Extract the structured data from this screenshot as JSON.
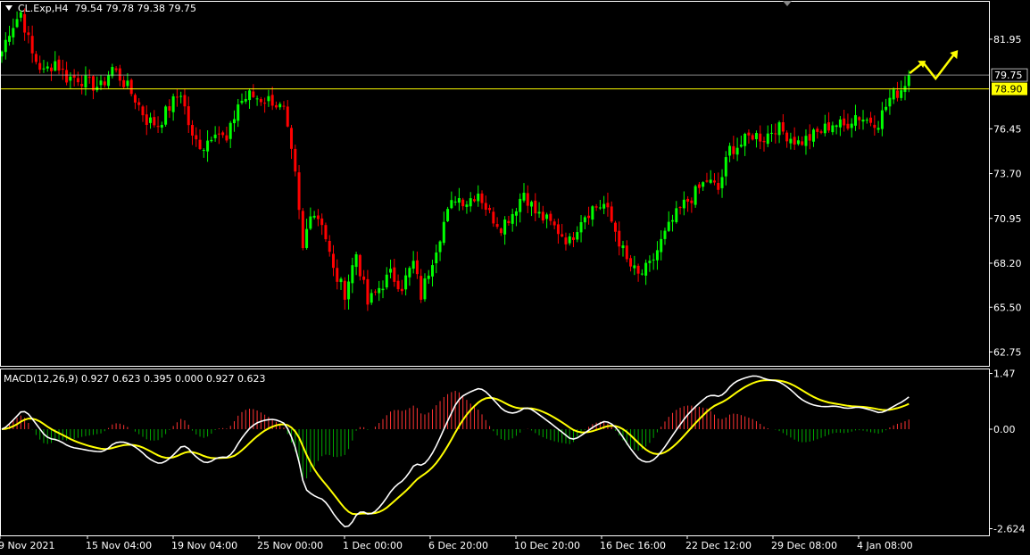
{
  "header": {
    "symbol": "CL.Exp,H4",
    "ohlc": "79.54 79.78 79.38 79.75"
  },
  "macd_header": {
    "label": "MACD(12,26,9) 0.927 0.623 0.395 0.000 0.927 0.623"
  },
  "colors": {
    "background": "#000000",
    "bull_candle": "#00ff00",
    "bear_candle": "#ff0000",
    "macd_line": "#ffffff",
    "signal_line": "#ffff00",
    "hist_pos": "#ff3333",
    "hist_neg": "#00aa00",
    "current_price_tag": "#ffff00",
    "axis": "#ffffff",
    "hline": "#c0c0c0"
  },
  "price_panel": {
    "ticks": [
      "81.95",
      "76.45",
      "73.70",
      "70.95",
      "68.20",
      "65.50",
      "62.75"
    ],
    "tick_values": [
      81.95,
      76.45,
      73.7,
      70.95,
      68.2,
      65.5,
      62.75
    ],
    "ylim": [
      61.9,
      84.3
    ],
    "hlines": [
      79.75,
      78.9
    ],
    "price_tags": [
      {
        "label": "79.75",
        "value": 79.75,
        "style": "line"
      },
      {
        "label": "78.90",
        "value": 78.9,
        "style": "box"
      }
    ]
  },
  "macd_panel": {
    "ticks": [
      "1.47",
      "0.00",
      "-2.624"
    ],
    "tick_values": [
      1.47,
      0.0,
      -2.624
    ],
    "ylim": [
      -2.8,
      1.6
    ]
  },
  "x_axis_labels": [
    "9 Nov 2021",
    "15 Nov 04:00",
    "19 Nov 04:00",
    "25 Nov 00:00",
    "1 Dec 00:00",
    "6 Dec 20:00",
    "10 Dec 20:00",
    "16 Dec 16:00",
    "22 Dec 12:00",
    "29 Dec 08:00",
    "4 Jan 08:00"
  ],
  "chart_data": {
    "type": "candlestick",
    "title": "CL.Exp,H4",
    "ylabel": "",
    "ylim": [
      61.9,
      84.3
    ],
    "grid": false,
    "close_path": [
      [
        0,
        81.2
      ],
      [
        2,
        82.5
      ],
      [
        5,
        83.6
      ],
      [
        8,
        81.0
      ],
      [
        11,
        79.9
      ],
      [
        14,
        80.6
      ],
      [
        17,
        79.6
      ],
      [
        20,
        79.6
      ],
      [
        23,
        79.2
      ],
      [
        26,
        79.0
      ],
      [
        29,
        80.2
      ],
      [
        32,
        79.3
      ],
      [
        35,
        78.3
      ],
      [
        38,
        77.0
      ],
      [
        41,
        76.7
      ],
      [
        44,
        77.8
      ],
      [
        47,
        78.7
      ],
      [
        50,
        75.8
      ],
      [
        53,
        75.4
      ],
      [
        56,
        76.5
      ],
      [
        59,
        75.6
      ],
      [
        62,
        78.0
      ],
      [
        65,
        78.5
      ],
      [
        68,
        78.3
      ],
      [
        71,
        78.2
      ],
      [
        74,
        77.5
      ],
      [
        77,
        73.5
      ],
      [
        79,
        69.0
      ],
      [
        81,
        71.5
      ],
      [
        84,
        70.8
      ],
      [
        87,
        67.7
      ],
      [
        90,
        66.4
      ],
      [
        93,
        68.8
      ],
      [
        96,
        65.7
      ],
      [
        99,
        66.7
      ],
      [
        102,
        67.5
      ],
      [
        105,
        66.8
      ],
      [
        108,
        68.2
      ],
      [
        110,
        66.2
      ],
      [
        113,
        68.5
      ],
      [
        116,
        70.7
      ],
      [
        119,
        72.3
      ],
      [
        122,
        72.0
      ],
      [
        125,
        72.6
      ],
      [
        128,
        71.2
      ],
      [
        131,
        70.5
      ],
      [
        134,
        71.3
      ],
      [
        137,
        72.6
      ],
      [
        140,
        71.3
      ],
      [
        143,
        70.8
      ],
      [
        146,
        70.2
      ],
      [
        149,
        69.5
      ],
      [
        152,
        71.0
      ],
      [
        155,
        71.6
      ],
      [
        158,
        71.8
      ],
      [
        161,
        70.2
      ],
      [
        164,
        68.3
      ],
      [
        167,
        67.4
      ],
      [
        170,
        68.0
      ],
      [
        173,
        69.5
      ],
      [
        176,
        70.8
      ],
      [
        179,
        71.8
      ],
      [
        182,
        72.5
      ],
      [
        185,
        73.3
      ],
      [
        188,
        72.7
      ],
      [
        191,
        75.2
      ],
      [
        194,
        75.5
      ],
      [
        197,
        76.1
      ],
      [
        200,
        75.9
      ],
      [
        203,
        76.6
      ],
      [
        206,
        76.1
      ],
      [
        209,
        75.6
      ],
      [
        212,
        75.9
      ],
      [
        215,
        76.3
      ],
      [
        218,
        76.8
      ],
      [
        221,
        76.6
      ],
      [
        224,
        77.3
      ],
      [
        227,
        77.0
      ],
      [
        230,
        76.9
      ],
      [
        233,
        78.3
      ],
      [
        236,
        78.9
      ],
      [
        238,
        79.75
      ]
    ]
  }
}
